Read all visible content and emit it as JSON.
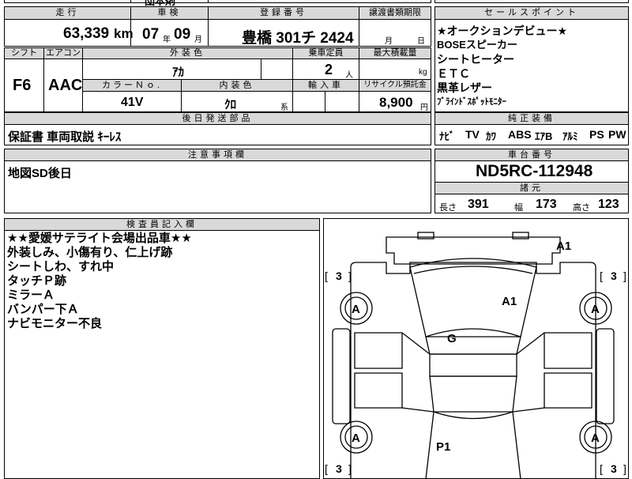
{
  "top_cut": {
    "a": "",
    "b": "団本剤"
  },
  "grid1": {
    "headers": {
      "mileage": "走行",
      "inspection": "車検",
      "registration": "登録番号",
      "transfer_deadline": "譲渡書類期限"
    },
    "mileage": {
      "value": "63,339",
      "unit": "km"
    },
    "inspection": {
      "year": "07",
      "year_unit": "年",
      "month": "09",
      "month_unit": "月"
    },
    "registration": {
      "value": "豊橋 301チ 2424"
    },
    "transfer": {
      "month_unit": "月",
      "day_unit": "日"
    }
  },
  "grid2": {
    "headers": {
      "shift": "シフト",
      "ac": "エアコン",
      "ext_color": "外装色",
      "capacity": "乗車定員",
      "max_load": "最大積載量",
      "color_no": "カラーＮｏ.",
      "int_color": "内装色",
      "import": "輸入車",
      "recycle": "リサイクル預託金"
    },
    "shift": "F6",
    "ac": "AAC",
    "ext_color": "ｱｶ",
    "capacity": "2",
    "capacity_unit": "人",
    "max_load_unit": "kg",
    "color_no": "41V",
    "int_color": "ｸﾛ",
    "int_suffix": "系",
    "recycle": "8,900",
    "recycle_unit": "円"
  },
  "later_parts": {
    "header": "後日発送部品",
    "value": "保証書 車両取説 ｷｰﾚｽ"
  },
  "notes": {
    "header": "注意事項欄",
    "value": "地図SD後日"
  },
  "sales_points": {
    "header": "セールスポイント",
    "items": [
      "★オークションデビュー★",
      "BOSEスピーカー",
      "シートヒーター",
      "ＥＴＣ",
      "黒革レザー",
      "ﾌﾞﾗｲﾝﾄﾞｽﾎﾟｯﾄﾓﾆﾀｰ"
    ]
  },
  "equipment": {
    "header": "純正装備",
    "items": [
      "ﾅﾋﾞ",
      "TV",
      "ｶﾜ",
      "ABS",
      "ｴｱB",
      "ｱﾙﾐ",
      "PS",
      "PW"
    ]
  },
  "chassis": {
    "header": "車台番号",
    "value": "ND5RC-112948"
  },
  "dims": {
    "header": "諸元",
    "length_label": "長さ",
    "length": "391",
    "width_label": "幅",
    "width": "173",
    "height_label": "高さ",
    "height": "123"
  },
  "inspector": {
    "header": "検査員記入欄",
    "lines": [
      "★★愛媛サテライト会場出品車★★",
      "外装しみ、小傷有り、仁上げ跡",
      "シートしわ、すれ中",
      "タッチＰ跡",
      "ミラーＡ",
      "バンパー下Ａ",
      "ナビモニター不良"
    ]
  },
  "diagram": {
    "marks": {
      "front_bumper": "A1",
      "hood": "A1",
      "roof": "G",
      "rear": "P1",
      "tire_fl": "A",
      "tire_fr": "A",
      "tire_rl": "A",
      "tire_rr": "A"
    },
    "tread": {
      "fl": "3",
      "fr": "3",
      "rl": "3",
      "rr": "3"
    }
  }
}
